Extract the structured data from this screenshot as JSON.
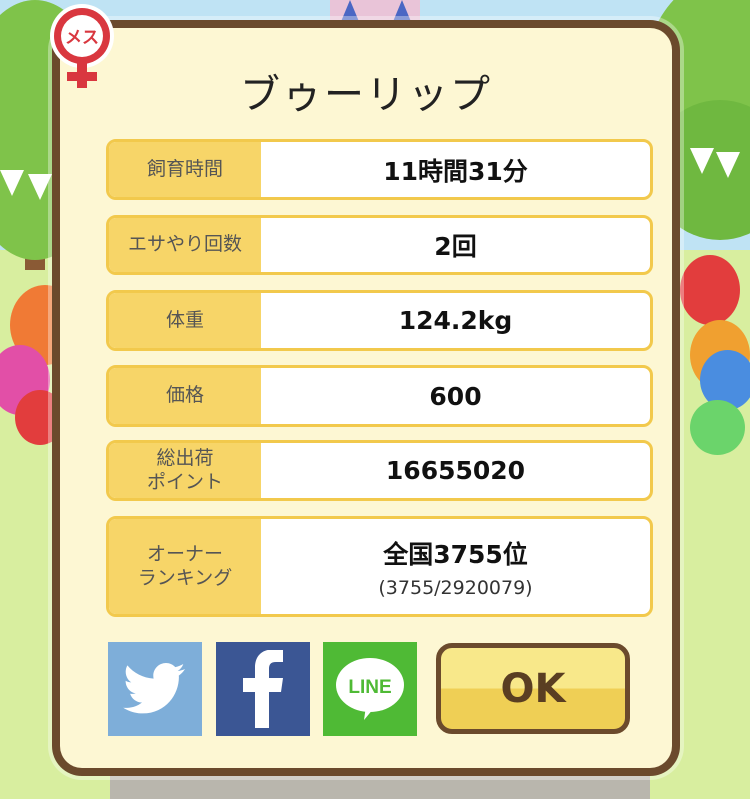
{
  "dialog": {
    "title": "ブゥーリップ",
    "gender_badge": "メス",
    "rows": [
      {
        "label": "飼育時間",
        "value": "11時間31分"
      },
      {
        "label": "エサやり回数",
        "value": "2回"
      },
      {
        "label": "体重",
        "value": "124.2kg"
      },
      {
        "label": "価格",
        "value": "600"
      },
      {
        "label": "総出荷\nポイント",
        "value": "16655020"
      },
      {
        "label": "オーナー\nランキング",
        "value": "全国3755位",
        "sub": "(3755/2920079)"
      }
    ],
    "share": {
      "twitter_icon": "twitter-bird-icon",
      "facebook_icon": "facebook-f-icon",
      "line_label": "LINE"
    },
    "ok_label": "OK"
  },
  "colors": {
    "frame": "#6b4a2c",
    "panel": "#fdf7d3",
    "label_bg": "#f7d568",
    "row_border": "#f2c94c",
    "badge_red": "#d9373f",
    "twitter": "#7eaed9",
    "facebook": "#3b5694",
    "line": "#4fba35"
  }
}
